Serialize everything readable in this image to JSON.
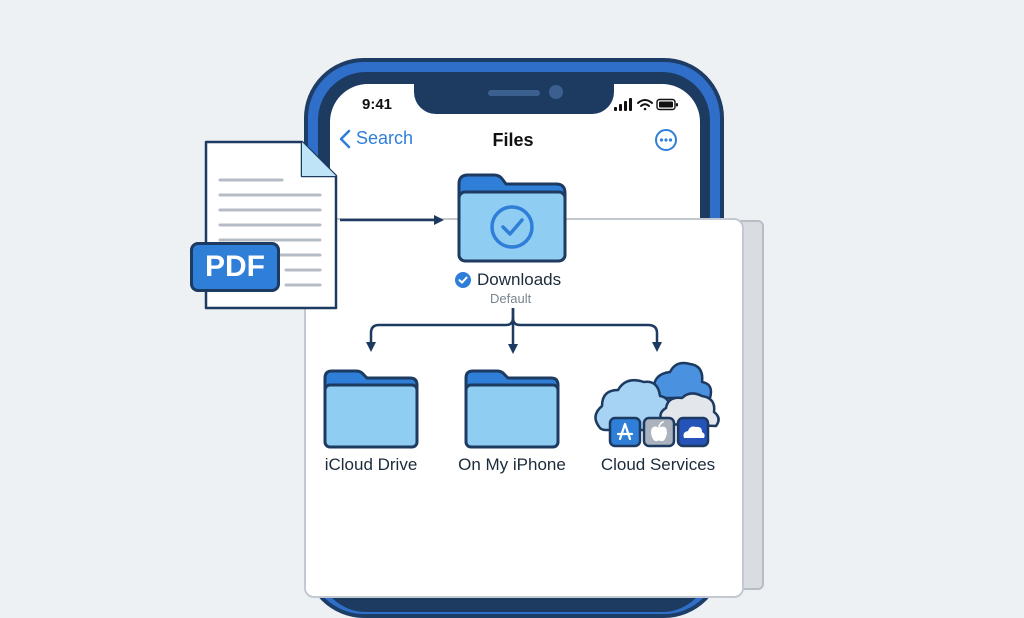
{
  "status_bar": {
    "time": "9:41"
  },
  "nav": {
    "back_label": "Search",
    "title": "Files"
  },
  "pdf_file": {
    "badge": "PDF"
  },
  "default_folder": {
    "name": "Downloads",
    "caption": "Default"
  },
  "destinations": [
    {
      "label": "iCloud Drive"
    },
    {
      "label": "On My iPhone"
    },
    {
      "label": "Cloud Services"
    }
  ],
  "colors": {
    "accent": "#2f7fd9",
    "folder_fill": "#8fcdf3",
    "folder_tab": "#2f7fd9",
    "outline": "#1d3a61"
  },
  "icons": {
    "back": "chevron-left-icon",
    "more": "ellipsis-circle-icon",
    "check": "checkmark-badge-icon",
    "app_store": "app-store-icon",
    "apple": "apple-logo-icon",
    "onedrive": "onedrive-cloud-icon"
  }
}
